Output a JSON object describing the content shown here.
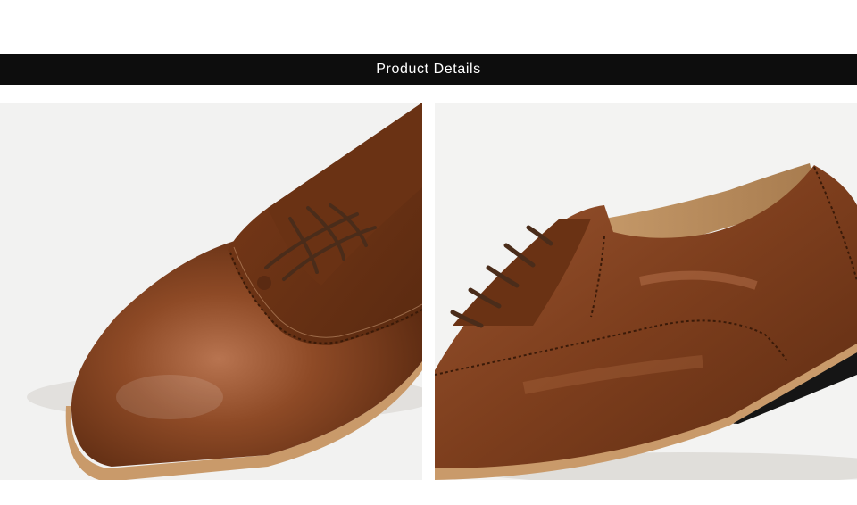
{
  "header": {
    "title": "Product Details"
  },
  "images": [
    {
      "subject": "toe-closeup"
    },
    {
      "subject": "side-lacing-closeup"
    }
  ],
  "colors": {
    "banner_bg": "#0d0d0d",
    "banner_text": "#ffffff",
    "leather": "#7a3f1f",
    "leather_light": "#a0603a",
    "sole_edge": "#c99a6a",
    "heel": "#151515",
    "lace": "#4a2c1a"
  }
}
